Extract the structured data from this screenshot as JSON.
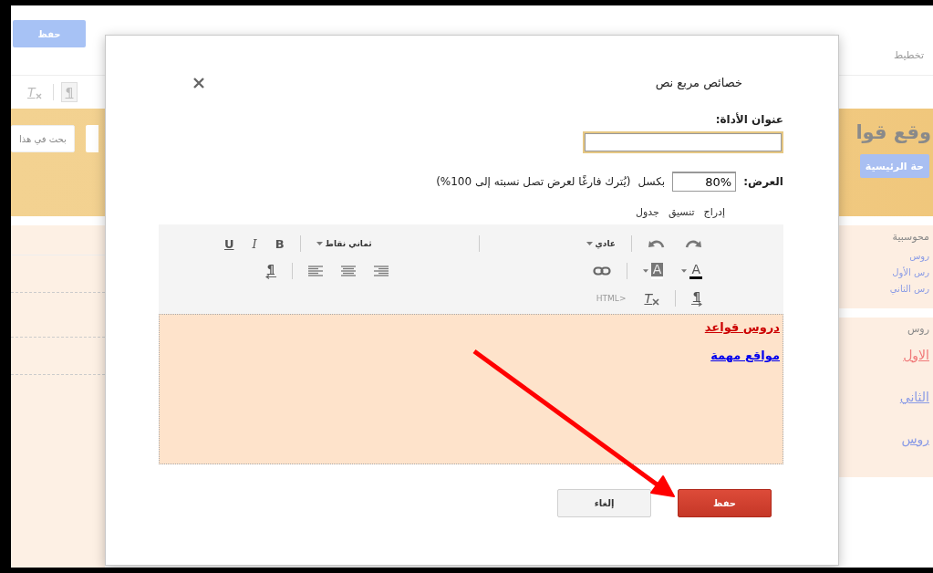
{
  "background": {
    "save_button": "حفظ",
    "tab": "تخطيط",
    "toolbar": {
      "clear_format": "T",
      "paragraph": "¶"
    },
    "search_button": "بحث في هذا",
    "blog_title": "وقع قوا",
    "home_tab": "حة الرئيسية",
    "sidebar_widgets": [
      {
        "title": "محوسبية",
        "links": [
          {
            "text": "روس"
          },
          {
            "text": "رس الأول"
          },
          {
            "text": "رس الثاني"
          }
        ]
      },
      {
        "title": "روس",
        "links": [
          {
            "text": "الاول",
            "color": "#f07a7a"
          },
          {
            "text": "الثاني",
            "color": "#8a9be6"
          },
          {
            "text": "روس",
            "color": "#8a9be6"
          }
        ]
      }
    ]
  },
  "dialog": {
    "title": "خصائص مربع نص",
    "title_field": {
      "label": "عنوان الأداة:"
    },
    "width_field": {
      "label": "العرض:",
      "value": "80%",
      "unit": "بكسل",
      "hint": "(يُترك فارغًا لعرض تصل نسبته إلى 100%)"
    },
    "editor": {
      "menus": [
        "إدراج",
        "تنسيق",
        "جدول"
      ],
      "toolbar": {
        "style": "عادي",
        "size": "ثماني نقاط",
        "bold": "B",
        "italic": "I",
        "underline": "U",
        "text_color": "A",
        "highlight": "A",
        "pilcrow_rtl": "¶",
        "pilcrow_ltr": "¶",
        "clear_format": "T",
        "html": "HTML>"
      },
      "links": [
        {
          "text": "دروس قواعد",
          "color": "#cc0000"
        },
        {
          "text": "مواقع مهمة",
          "color": "#0000ee"
        }
      ]
    },
    "buttons": [
      {
        "label": "حفظ",
        "kind": "primary"
      },
      {
        "label": "إلغاء",
        "kind": "secondary"
      }
    ]
  }
}
